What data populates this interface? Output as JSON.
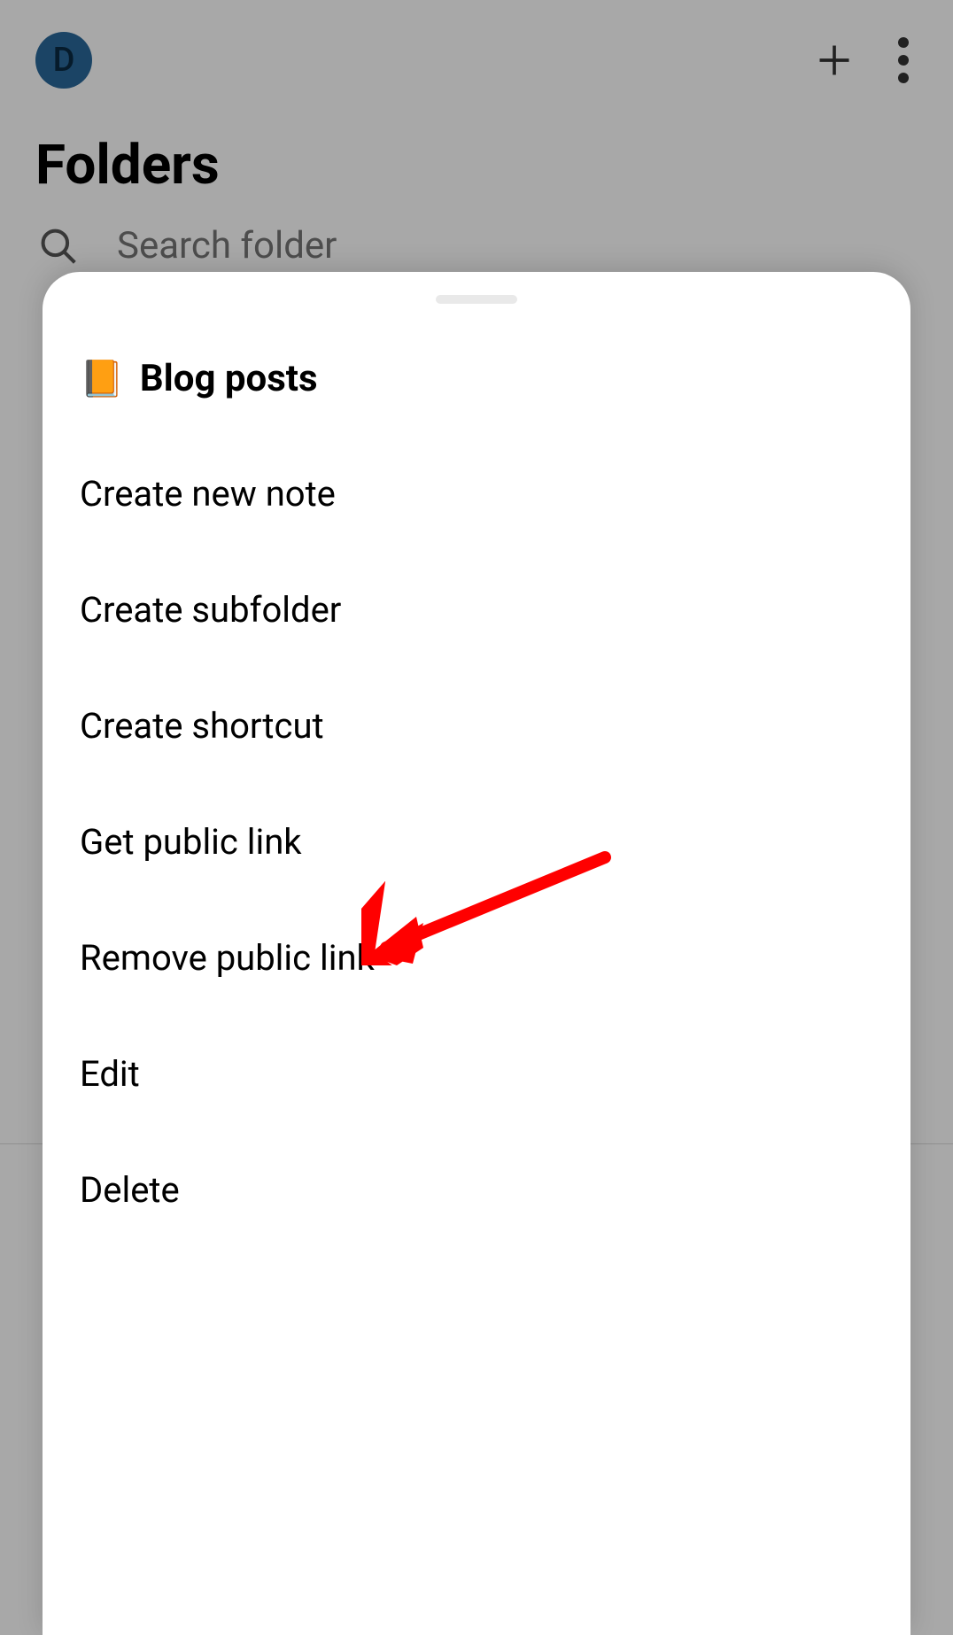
{
  "header": {
    "avatar_letter": "D",
    "avatar_bg": "#2a6899"
  },
  "title": "Folders",
  "search": {
    "placeholder": "Search folder"
  },
  "sheet": {
    "icon": "📙",
    "title": "Blog posts",
    "items": [
      {
        "label": "Create new note"
      },
      {
        "label": "Create subfolder"
      },
      {
        "label": "Create shortcut"
      },
      {
        "label": "Get public link"
      },
      {
        "label": "Remove public link"
      },
      {
        "label": "Edit"
      },
      {
        "label": "Delete"
      }
    ]
  },
  "annotation": {
    "arrow_color": "#ff0000",
    "target": "remove-public-link"
  }
}
